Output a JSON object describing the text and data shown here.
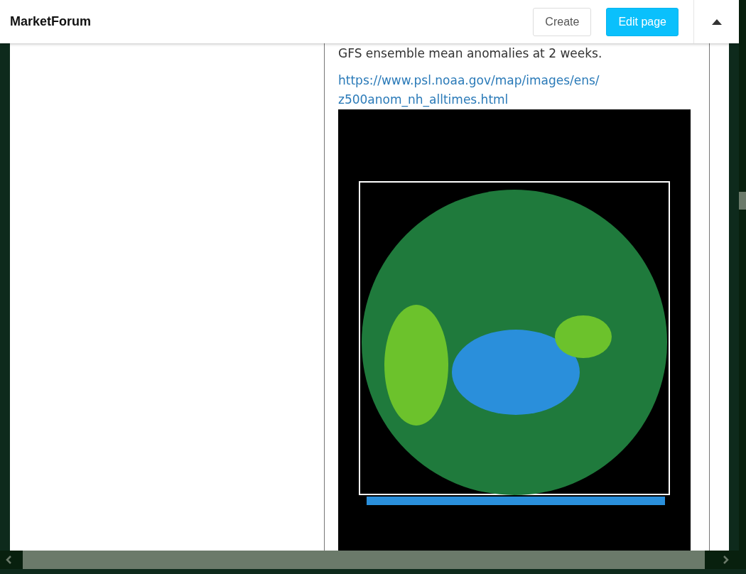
{
  "header": {
    "brand": "MarketForum",
    "buttons": [
      {
        "label": "Create",
        "kind": "plain"
      },
      {
        "label": "Edit page",
        "kind": "primary"
      }
    ]
  },
  "post": {
    "text": "GFS ensemble mean anomalies at 2 weeks.",
    "link": "https://www.psl.noaa.gov/map/images/ens/z500anom_nh_alltimes.html"
  }
}
